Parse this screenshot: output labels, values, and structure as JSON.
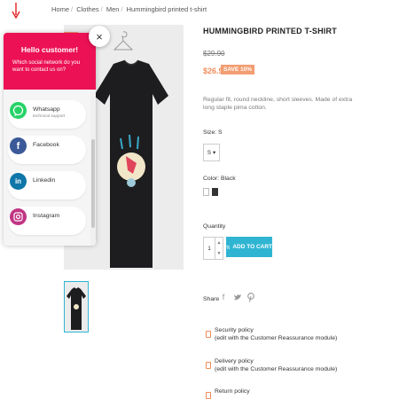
{
  "breadcrumb": [
    "Home",
    "Clothes",
    "Men",
    "Hummingbird printed t-shirt"
  ],
  "product": {
    "title": "HUMMINGBIRD PRINTED T-SHIRT",
    "old_price": "$29.90",
    "price": "$26.91",
    "discount": "SAVE 10%",
    "description": "Regular fit, round neckline, short sleeves. Made of extra long staple pima cotton.",
    "size_label": "Size: S",
    "size_value": "S",
    "color_label": "Color: Black",
    "quantity_label": "Quantity",
    "quantity_value": "1",
    "add_to_cart": "ADD TO CART",
    "share_label": "Share"
  },
  "reassurance": [
    {
      "title": "Security policy",
      "note": "(edit with the Customer Reassurance module)"
    },
    {
      "title": "Delivery policy",
      "note": "(edit with the Customer Reassurance module)"
    },
    {
      "title": "Return policy"
    }
  ],
  "widget": {
    "greeting": "Hello customer!",
    "question": "Which social network do you want to contact us on?",
    "close_symbol": "×",
    "contacts": [
      {
        "name": "Whatsapp",
        "subtitle": "technical support",
        "color": "#25d366"
      },
      {
        "name": "Facebook",
        "color": "#3b5998"
      },
      {
        "name": "Linkedin",
        "color": "#0e76a8"
      },
      {
        "name": "Instagram",
        "color": "#c13584"
      }
    ]
  },
  "colors": {
    "accent": "#2fb5d2",
    "sale": "#f39d72",
    "widget_header": "#ec1155"
  }
}
